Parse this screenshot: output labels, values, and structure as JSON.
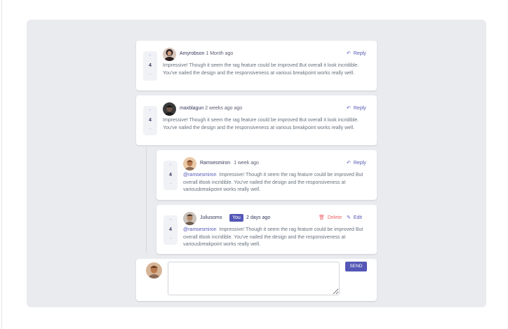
{
  "colors": {
    "accent": "#5457b6",
    "danger": "#ed6468",
    "background": "#eaebef",
    "card": "#ffffff",
    "text": "#67727e",
    "heading": "#33365a"
  },
  "comments": [
    {
      "score": "4",
      "username": "Amyrobson",
      "date": "1 Month ago",
      "reply_label": "Reply",
      "content": "Impressive! Though it seem the rag feature could be improved But overall it look incridible. You've nailed the design and the responsiveness at various breakpoint works really well."
    },
    {
      "score": "4",
      "username": "maxblagun",
      "date": "2 weeks ago ago",
      "reply_label": "Reply",
      "content": "Impressive! Though it seem the rag feature could be improved But overall it look incridible. You've nailed the design and the responsiveness at various breakpoint works really well."
    }
  ],
  "replies": [
    {
      "score": "4",
      "username": "Ramsesmiron",
      "date": "1 week ago",
      "reply_label": "Reply",
      "mention": "@ramsesmiron",
      "content": "Impressive! Though it seem the rag feature could be improved But overall itlook incridible. You've nailed the design and the responsiveness at variousbreakpoint works really well."
    },
    {
      "score": "4",
      "username": "Juliusomo",
      "you_label": "You",
      "date": "2 days ago",
      "delete_label": "Delete",
      "edit_label": "Edit",
      "mention": "@ramsesmiron",
      "content": "Impressive! Though it seem the rag feature could be improved But overall itlook incridible. You've nailed the design and the responsiveness at variousbreakpoint works really well."
    }
  ],
  "composer": {
    "placeholder": "",
    "send_label": "SEND"
  },
  "vote": {
    "plus": "+",
    "minus": "−"
  },
  "icons": {
    "reply": "reply-arrow-icon",
    "delete": "trash-icon",
    "edit": "pencil-icon"
  }
}
